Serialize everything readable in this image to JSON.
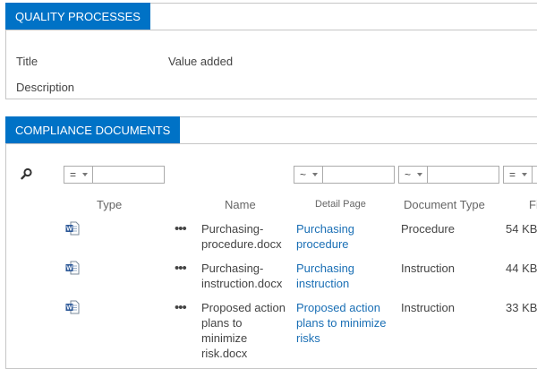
{
  "quality_processes": {
    "tab_label": "QUALITY PROCESSES",
    "fields": [
      {
        "label": "Title",
        "value": "Value added"
      },
      {
        "label": "Description",
        "value": ""
      }
    ]
  },
  "compliance_documents": {
    "tab_label": "COMPLIANCE DOCUMENTS",
    "filters": [
      {
        "operator": "=",
        "value": ""
      },
      {
        "operator": "~",
        "value": ""
      },
      {
        "operator": "~",
        "value": ""
      },
      {
        "operator": "=",
        "value": ""
      }
    ],
    "columns": {
      "type": "Type",
      "name": "Name",
      "detail_page": "Detail Page",
      "document_type": "Document Type",
      "file_size": "Fi"
    },
    "rows": [
      {
        "file_icon": "word-doc-icon",
        "actions": "•••",
        "name": "Purchasing-procedure.docx",
        "detail_page": "Purchasing procedure",
        "document_type": "Procedure",
        "file_size": "54 KB"
      },
      {
        "file_icon": "word-doc-icon",
        "actions": "•••",
        "name": "Purchasing-instruction.docx",
        "detail_page": "Purchasing instruction",
        "document_type": "Instruction",
        "file_size": "44 KB"
      },
      {
        "file_icon": "word-doc-icon",
        "actions": "•••",
        "name": "Proposed action plans to minimize risk.docx",
        "detail_page": "Proposed action plans to minimize risks",
        "document_type": "Instruction",
        "file_size": "33 KB"
      }
    ]
  },
  "colors": {
    "accent": "#0072c6",
    "link": "#1a6fb5",
    "border": "#c6c6c6"
  }
}
